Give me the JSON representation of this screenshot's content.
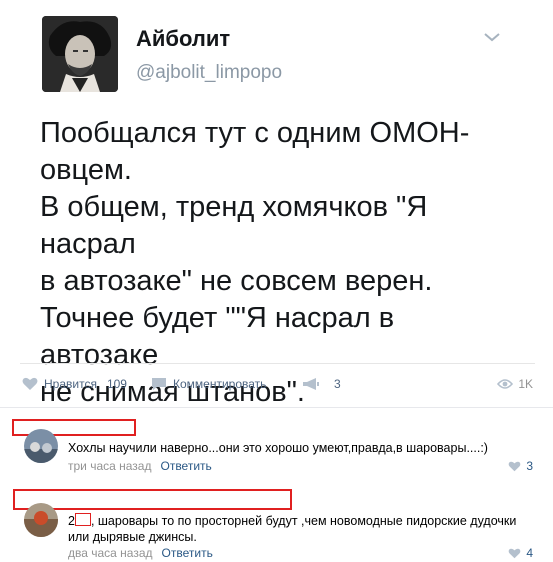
{
  "tweet": {
    "display_name": "Айболит",
    "handle": "@ajbolit_limpopo",
    "text": "Пообщался тут с одним ОМОН-\nовцем.\nВ общем, тренд хомячков \"Я насрал\nв автозаке\" не совсем верен.\nТочнее будет \"\"Я насрал в автозаке\nне снимая штанов\"."
  },
  "actions": {
    "like_label": "Нравится",
    "like_count": "109",
    "comment_label": "Комментировать",
    "share_count": "3",
    "views_count": "1K"
  },
  "comments": [
    {
      "text": "Хохлы научили наверно...они это хорошо умеют,правда,в шаровары....:)",
      "time": "три часа назад",
      "reply_label": "Ответить",
      "likes": "3"
    },
    {
      "text_prefix": "2",
      "text": ", шаровары то по просторней будут ,чем новомодные пидорские дудочки или дырявые джинсы.",
      "time": "два часа назад",
      "reply_label": "Ответить",
      "likes": "4"
    }
  ],
  "colors": {
    "link": "#2a5885",
    "muted": "#939393",
    "redaction": "#e02020"
  }
}
